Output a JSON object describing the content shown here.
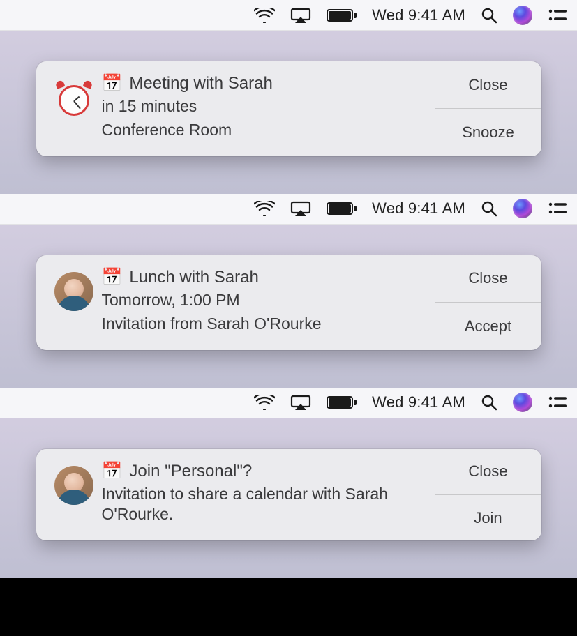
{
  "menubar": {
    "clock": "Wed 9:41 AM"
  },
  "panels": [
    {
      "icon_type": "alarm",
      "cal_emoji": "📅",
      "title": "Meeting with Sarah",
      "line1": "in 15 minutes",
      "line2": "Conference Room",
      "actions": [
        "Close",
        "Snooze"
      ]
    },
    {
      "icon_type": "avatar",
      "cal_emoji": "📅",
      "title": "Lunch with Sarah",
      "line1": "Tomorrow, 1:00 PM",
      "line2": "Invitation from Sarah O'Rourke",
      "actions": [
        "Close",
        "Accept"
      ]
    },
    {
      "icon_type": "avatar",
      "cal_emoji": "📅",
      "title": "Join \"Personal\"?",
      "line1": "Invitation to share a calendar with Sarah O'Rourke.",
      "line2": "",
      "actions": [
        "Close",
        "Join"
      ]
    }
  ]
}
